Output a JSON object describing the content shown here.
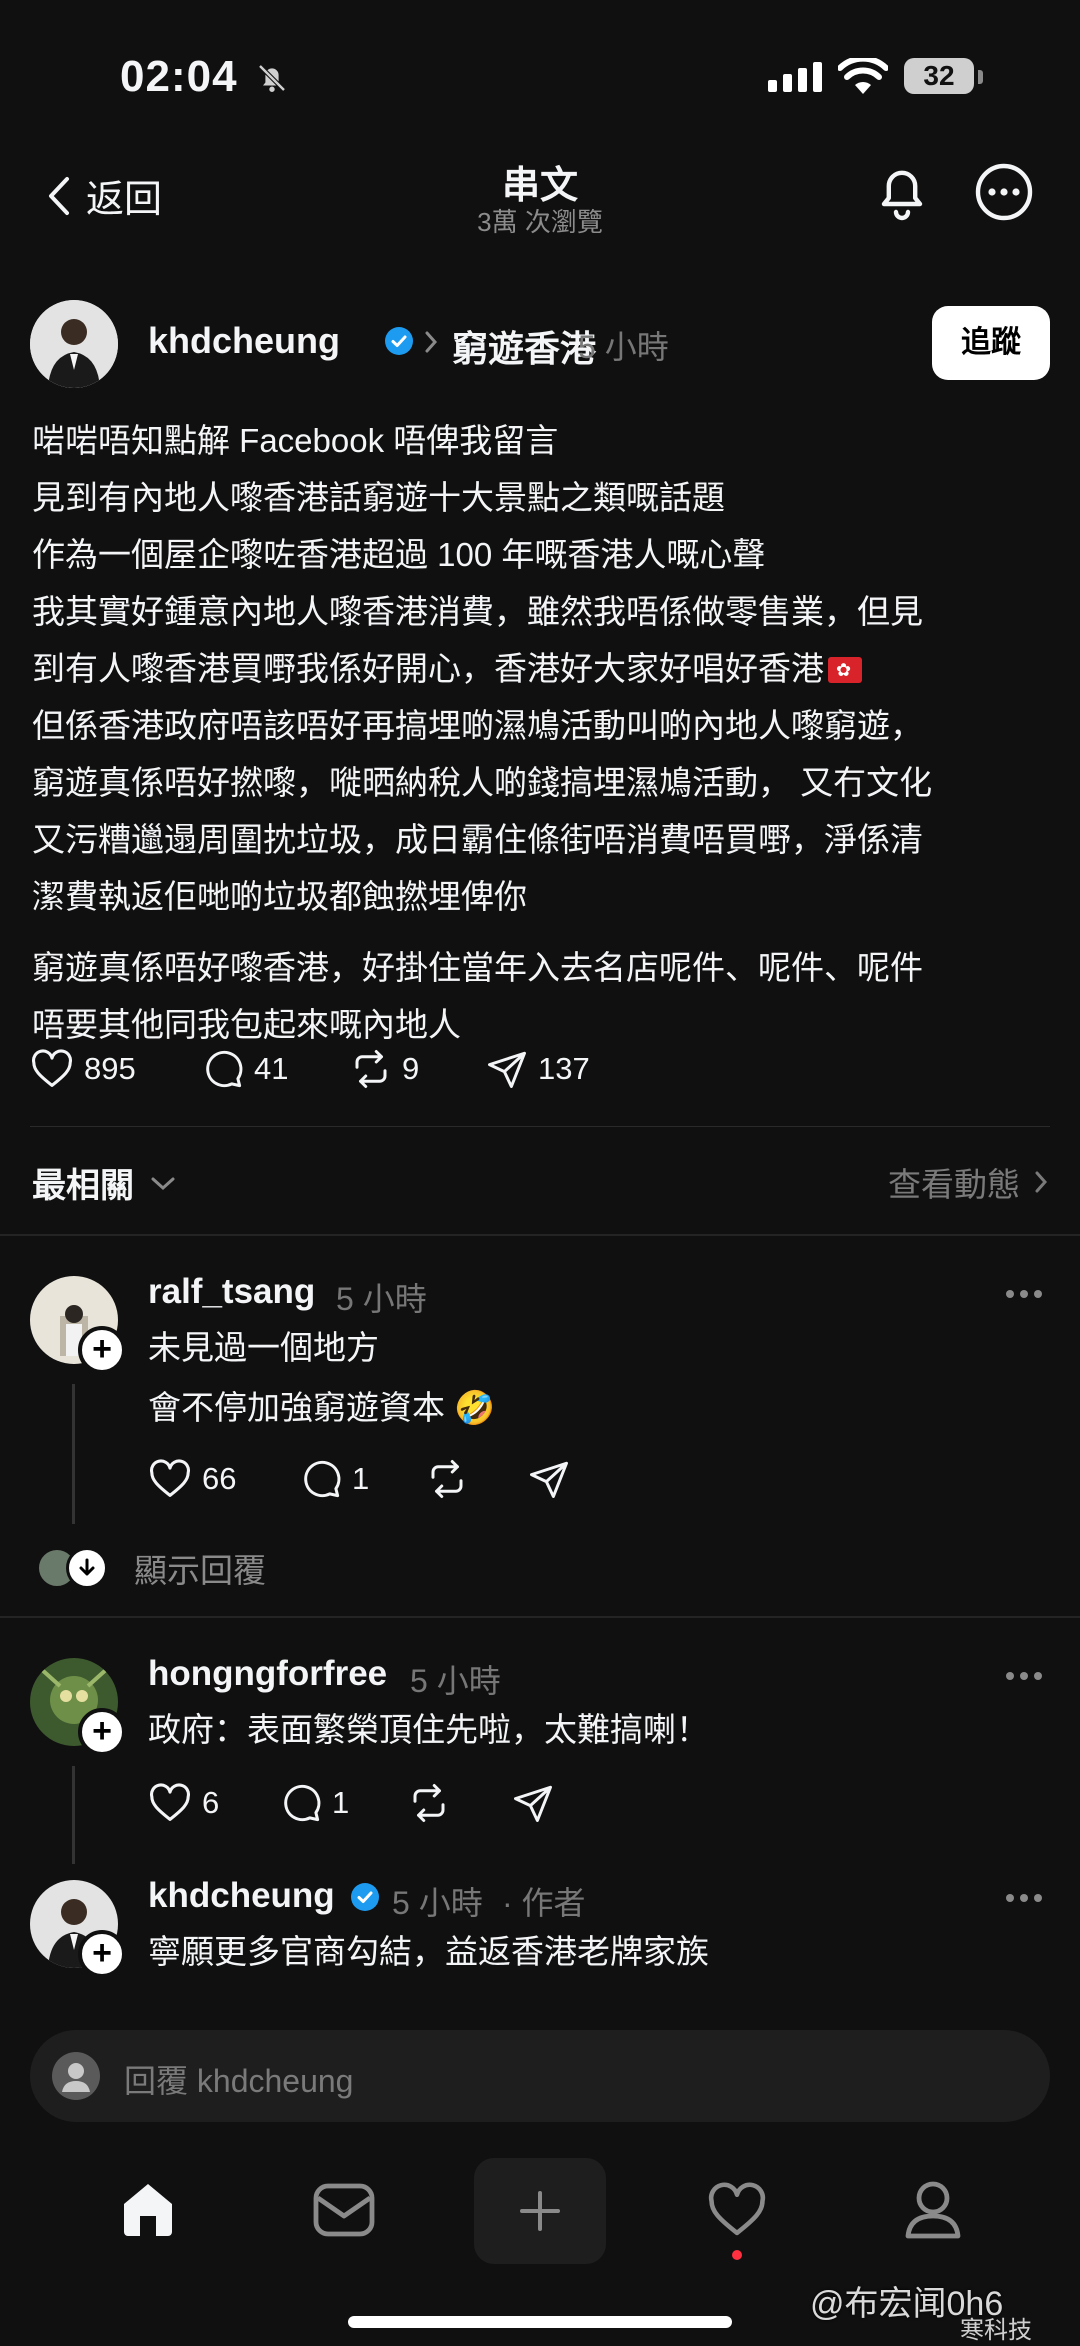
{
  "status_bar": {
    "time": "02:04",
    "battery": "32"
  },
  "nav": {
    "back_label": "返回",
    "title": "串文",
    "subtitle": "3萬 次瀏覽"
  },
  "post": {
    "username": "khdcheung",
    "topic": "窮遊香港",
    "time": "5 小時",
    "follow_label": "追蹤",
    "lines": [
      "啱啱唔知點解 Facebook 唔俾我留言",
      "見到有內地人嚟香港話窮遊十大景點之類嘅話題",
      "作為一個屋企嚟咗香港超過 100 年嘅香港人嘅心聲",
      "我其實好鍾意內地人嚟香港消費，雖然我唔係做零售業，但見",
      "到有人嚟香港買嘢我係好開心，香港好大家好唱好香港",
      "但係香港政府唔該唔好再搞埋啲濕鳩活動叫啲內地人嚟窮遊，",
      "窮遊真係唔好撚嚟，嘥晒納稅人啲錢搞埋濕鳩活動， 又冇文化",
      "又污糟邋遢周圍抌垃圾，成日霸住條街唔消費唔買嘢，淨係清",
      "潔費執返佢哋啲垃圾都蝕撚埋俾你"
    ],
    "lines2": [
      "窮遊真係唔好嚟香港，好掛住當年入去名店呢件、呢件、呢件",
      "唔要其他同我包起來嘅內地人"
    ],
    "likes": "895",
    "comments": "41",
    "reposts": "9",
    "shares": "137"
  },
  "sort": {
    "label": "最相關",
    "activity_label": "查看動態"
  },
  "comments": [
    {
      "username": "ralf_tsang",
      "time": "5 小時",
      "lines": [
        "未見過一個地方",
        "會不停加強窮遊資本 🤣"
      ],
      "likes": "66",
      "replies": "1"
    },
    {
      "username": "hongngforfree",
      "time": "5 小時",
      "lines": [
        "政府：表面繁榮頂住先啦，太難搞喇！"
      ],
      "likes": "6",
      "replies": "1"
    },
    {
      "username": "khdcheung",
      "time": "5 小時",
      "author_tag": "· 作者",
      "lines": [
        "寧願更多官商勾結，益返香港老牌家族"
      ]
    }
  ],
  "show_replies_label": "顯示回覆",
  "reply_bar": {
    "placeholder": "回覆 khdcheung"
  },
  "watermark": {
    "text": "@布宏闻0h6",
    "sub": "寒科技"
  },
  "colors": {
    "background": "#101010",
    "verified": "#1d9bf0",
    "activity_dot": "#ff3040"
  },
  "icons": {
    "nav": [
      "chevron-left-icon",
      "bell-icon",
      "more-icon"
    ],
    "tabs": [
      "home-icon",
      "inbox-icon",
      "plus-icon",
      "heart-icon",
      "profile-icon"
    ]
  }
}
